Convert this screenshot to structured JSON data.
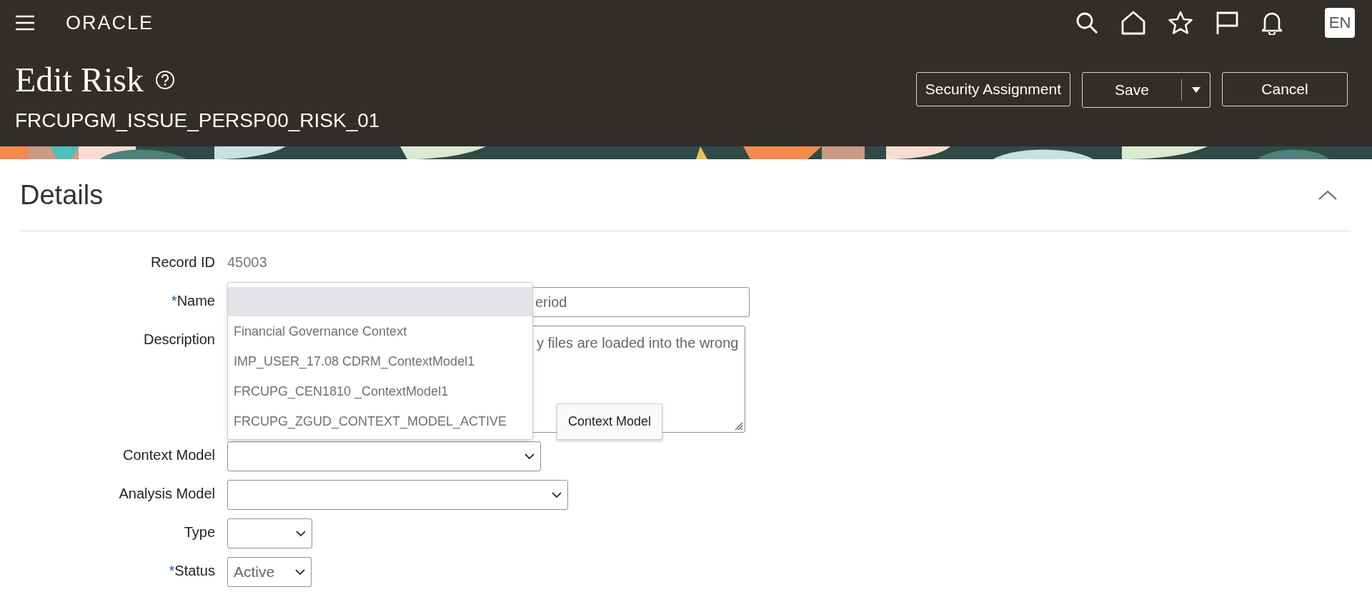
{
  "header": {
    "brand": "ORACLE",
    "language": "EN"
  },
  "page": {
    "title": "Edit Risk",
    "subtitle": "FRCUPGM_ISSUE_PERSP00_RISK_01"
  },
  "actions": [
    {
      "label": "Security Assignment",
      "kind": "plain"
    },
    {
      "label": "Save",
      "kind": "split"
    },
    {
      "label": "Cancel",
      "kind": "plain"
    }
  ],
  "section": {
    "title": "Details",
    "expanded": true
  },
  "fields": [
    {
      "label": "Record ID",
      "kind": "readonly",
      "required": false,
      "value": "45003"
    },
    {
      "label": "Name",
      "kind": "text",
      "required": true,
      "value": "eriod"
    },
    {
      "label": "Description",
      "kind": "textarea",
      "required": false,
      "value": "y files are loaded into the wrong"
    },
    {
      "label": "Context Model",
      "kind": "select",
      "required": false,
      "open": true
    },
    {
      "label": "Analysis Model",
      "kind": "select",
      "required": false,
      "open": false
    },
    {
      "label": "Type",
      "kind": "select",
      "required": false,
      "open": false
    },
    {
      "label": "Status",
      "kind": "select",
      "required": true,
      "open": false,
      "value": "Active"
    }
  ],
  "dropdown": {
    "blank_row_highlighted": true,
    "options": [
      {
        "label": "Financial Governance Context",
        "selected": false
      },
      {
        "label": "IMP_USER_17.08 CDRM_ContextModel1",
        "selected": false
      },
      {
        "label": "FRCUPG_CEN1810 _ContextModel1",
        "selected": false
      },
      {
        "label": "FRCUPG_ZGUD_CONTEXT_MODEL_ACTIVE",
        "selected": false
      }
    ]
  },
  "tooltip": {
    "text": "Context Model"
  },
  "required_mark": "*"
}
